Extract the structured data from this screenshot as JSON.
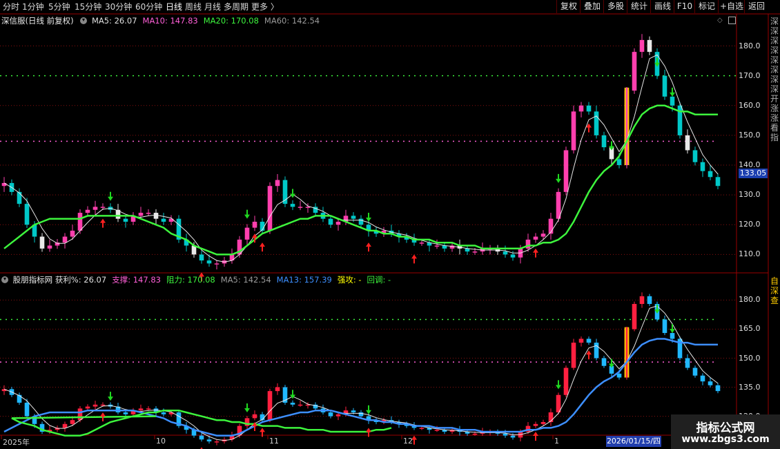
{
  "toolbar": {
    "periods": [
      "分时",
      "1分钟",
      "5分钟",
      "15分钟",
      "30分钟",
      "60分钟",
      "日线",
      "周线",
      "月线",
      "多周期",
      "更多 〉"
    ],
    "active_period": "日线",
    "right_buttons": [
      "复权",
      "叠加",
      "多股",
      "统计",
      "画线",
      "F10",
      "标记",
      "+自选",
      "返回"
    ]
  },
  "main_panel": {
    "stock_title": "深信服(日线 前复权)",
    "ma_labels": [
      {
        "text": "MA5: 26.07",
        "color": "#e0e0e0"
      },
      {
        "text": "MA10: 147.83",
        "color": "#ff5fd7"
      },
      {
        "text": "MA20: 170.08",
        "color": "#3df53d"
      },
      {
        "text": "MA60: 142.54",
        "color": "#9a9a9a"
      }
    ],
    "price_axis": [
      "180.0",
      "170.0",
      "160.0",
      "150.0",
      "140.0",
      "130.0",
      "120.0",
      "110.0"
    ],
    "current_price": "133.05"
  },
  "indicator_panel": {
    "title": "股朋指标网",
    "labels": [
      {
        "text": "获利%: 26.07",
        "color": "#e0e0e0"
      },
      {
        "text": "支撑: 147.83",
        "color": "#ff5fd7"
      },
      {
        "text": "阻力: 170.08",
        "color": "#3df53d"
      },
      {
        "text": "MA5: 142.54",
        "color": "#9a9a9a"
      },
      {
        "text": "MA13: 157.39",
        "color": "#3d8fff"
      },
      {
        "text": "强攻: -",
        "color": "#ffff00"
      },
      {
        "text": "回调: -",
        "color": "#3df53d"
      }
    ],
    "price_axis": [
      "180.0",
      "165.0",
      "150.0",
      "135.0",
      "120.0"
    ]
  },
  "date_axis": {
    "labels": [
      "2025年",
      "10",
      "11",
      "12",
      "1"
    ],
    "cursor_date": "2026/01/15/四"
  },
  "right_sidebar": {
    "top_text": "深深深深深深深深 开涨  涨 看 指",
    "bottom_text": "自 深 查"
  },
  "watermark": {
    "line1": "指标公式网",
    "line2": "www.zbgs3.com"
  },
  "chart_data": {
    "type": "candlestick",
    "y_axis_main": [
      105,
      188
    ],
    "y_axis_indicator": [
      112,
      188
    ],
    "closes": [
      134,
      131,
      127,
      120,
      116,
      112,
      113,
      114,
      116,
      118,
      124,
      125,
      126,
      126,
      125,
      122,
      121,
      123,
      124,
      124,
      122,
      121,
      122,
      115,
      113,
      110,
      108,
      107,
      107,
      108,
      110,
      115,
      119,
      121,
      118,
      133,
      135,
      127,
      126,
      126,
      126,
      124,
      122,
      120,
      121,
      123,
      122,
      120,
      118,
      117,
      118,
      117,
      116,
      115,
      114,
      114,
      113,
      113,
      112,
      113,
      112,
      111,
      111,
      112,
      112,
      111,
      110,
      109,
      112,
      115,
      116,
      117,
      122,
      131,
      145,
      158,
      160,
      158,
      150,
      146,
      142,
      140,
      165,
      178,
      182,
      178,
      170,
      163,
      160,
      150,
      145,
      141,
      138,
      136,
      133
    ],
    "ma_green": [
      112,
      114,
      116,
      118,
      120,
      121,
      122,
      122,
      122,
      122,
      122,
      123,
      123,
      123,
      123,
      123,
      123,
      123,
      122,
      121,
      120,
      119,
      117,
      116,
      115,
      113,
      112,
      111,
      110,
      110,
      110,
      111,
      113,
      115,
      117,
      118,
      119,
      120,
      121,
      122,
      122,
      123,
      123,
      123,
      122,
      121,
      120,
      119,
      118,
      118,
      117,
      117,
      116,
      116,
      115,
      115,
      115,
      114,
      114,
      114,
      113,
      113,
      113,
      112,
      112,
      112,
      112,
      112,
      112,
      113,
      113,
      114,
      114,
      115,
      117,
      121,
      126,
      131,
      135,
      138,
      140,
      143,
      148,
      153,
      157,
      159,
      160,
      160,
      159,
      158,
      158,
      157,
      157,
      157,
      157
    ],
    "signals_up": [
      13,
      26,
      33,
      34,
      48,
      54,
      70,
      77
    ],
    "signals_down": [
      14,
      32,
      38,
      48,
      73,
      80,
      86,
      88
    ],
    "series": [
      {
        "name": "MA5",
        "values": [
          142.54
        ]
      },
      {
        "name": "MA10",
        "values": [
          147.83
        ]
      },
      {
        "name": "MA20",
        "values": [
          170.08
        ]
      },
      {
        "name": "MA60",
        "values": [
          142.54
        ]
      }
    ]
  }
}
